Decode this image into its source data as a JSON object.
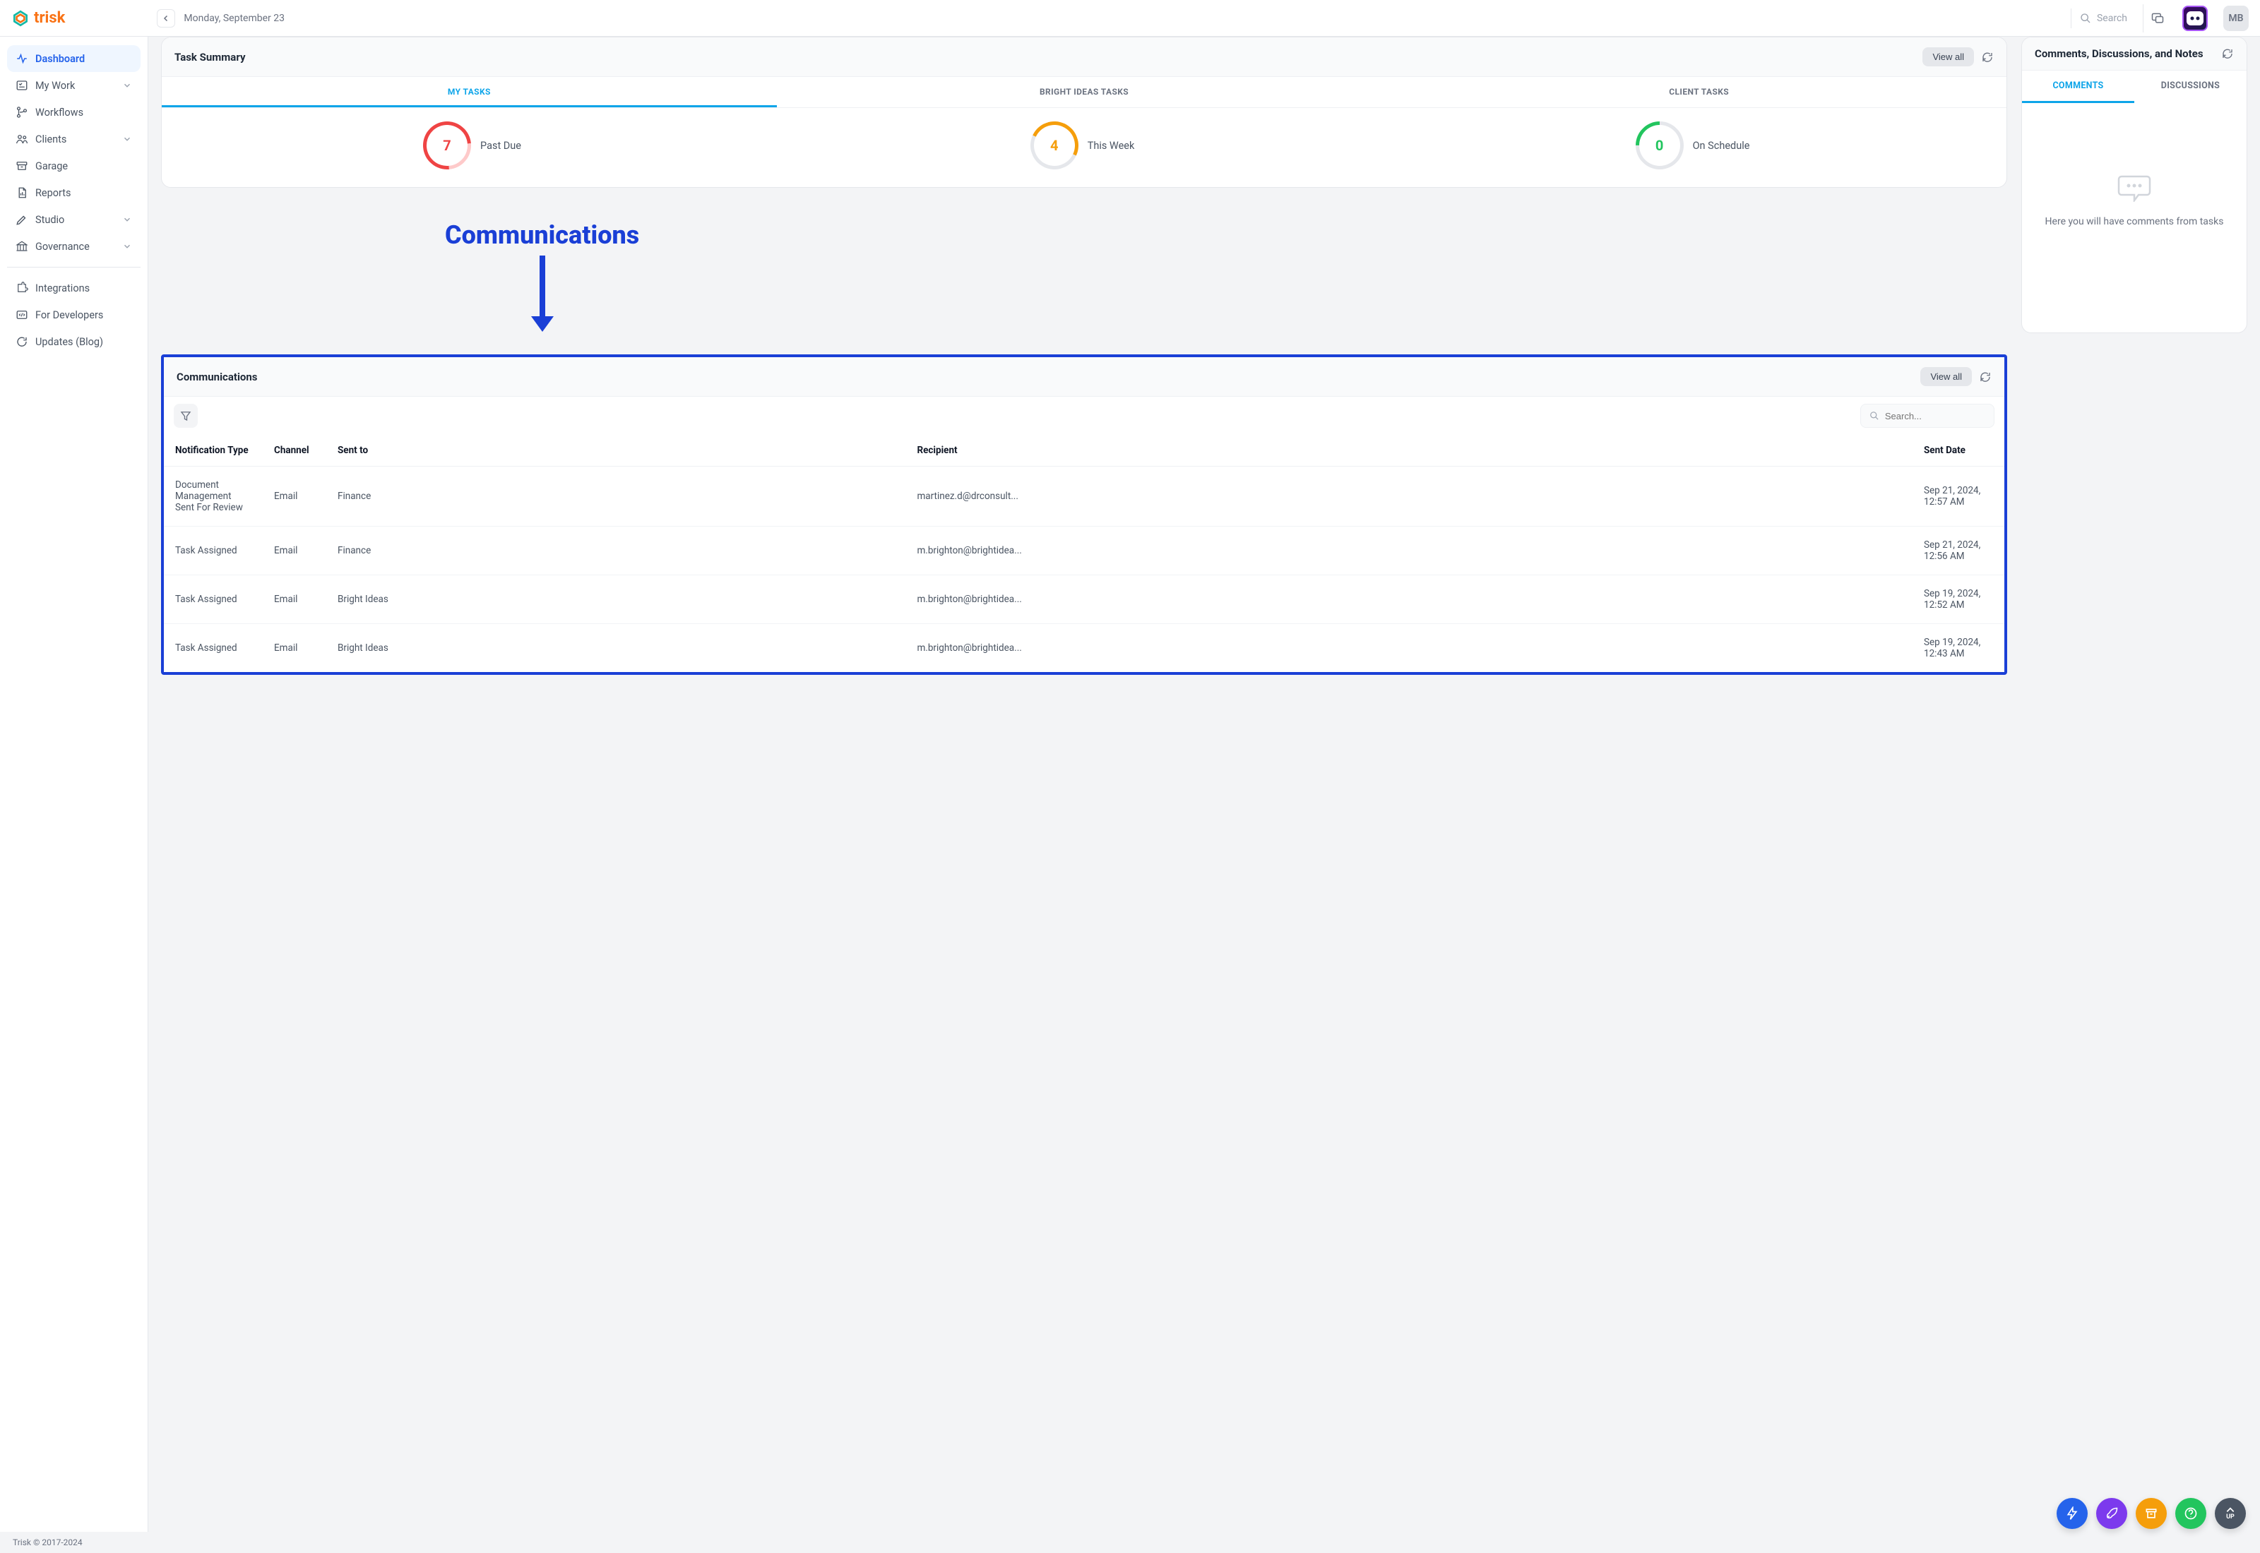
{
  "brand": "trisk",
  "date": "Monday, September 23",
  "search_placeholder": "Search",
  "user_initials": "MB",
  "sidebar": {
    "items": [
      {
        "label": "Dashboard"
      },
      {
        "label": "My Work"
      },
      {
        "label": "Workflows"
      },
      {
        "label": "Clients"
      },
      {
        "label": "Garage"
      },
      {
        "label": "Reports"
      },
      {
        "label": "Studio"
      },
      {
        "label": "Governance"
      }
    ],
    "secondary": [
      {
        "label": "Integrations"
      },
      {
        "label": "For Developers"
      },
      {
        "label": "Updates (Blog)"
      }
    ]
  },
  "task_summary": {
    "title": "Task Summary",
    "view_all": "View all",
    "tabs": [
      "MY TASKS",
      "BRIGHT IDEAS TASKS",
      "CLIENT TASKS"
    ],
    "stats": [
      {
        "value": "7",
        "label": "Past Due"
      },
      {
        "value": "4",
        "label": "This Week"
      },
      {
        "value": "0",
        "label": "On Schedule"
      }
    ]
  },
  "comments_panel": {
    "title": "Comments, Discussions, and Notes",
    "tabs": [
      "COMMENTS",
      "DISCUSSIONS"
    ],
    "empty_text": "Here you will have comments from tasks"
  },
  "annotation_label": "Communications",
  "communications": {
    "title": "Communications",
    "view_all": "View all",
    "search_placeholder": "Search...",
    "columns": [
      "Notification Type",
      "Channel",
      "Sent to",
      "Recipient",
      "Sent Date"
    ],
    "rows": [
      {
        "type": "Document Management Sent For Review",
        "channel": "Email",
        "sent_to": "Finance",
        "recipient": "martinez.d@drconsult...",
        "date": "Sep 21, 2024, 12:57 AM"
      },
      {
        "type": "Task Assigned",
        "channel": "Email",
        "sent_to": "Finance",
        "recipient": "m.brighton@brightidea...",
        "date": "Sep 21, 2024, 12:56 AM"
      },
      {
        "type": "Task Assigned",
        "channel": "Email",
        "sent_to": "Bright Ideas",
        "recipient": "m.brighton@brightidea...",
        "date": "Sep 19, 2024, 12:52 AM"
      },
      {
        "type": "Task Assigned",
        "channel": "Email",
        "sent_to": "Bright Ideas",
        "recipient": "m.brighton@brightidea...",
        "date": "Sep 19, 2024, 12:43 AM"
      }
    ]
  },
  "up_label": "UP",
  "footer": "Trisk © 2017-2024"
}
